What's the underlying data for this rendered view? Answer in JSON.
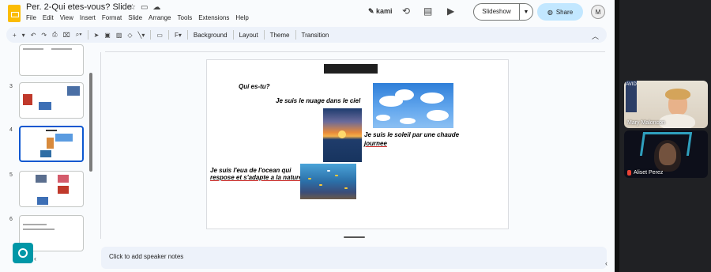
{
  "app": {
    "title": "Per. 2-Qui etes-vous? Slide",
    "menu": [
      "File",
      "Edit",
      "View",
      "Insert",
      "Format",
      "Slide",
      "Arrange",
      "Tools",
      "Extensions",
      "Help"
    ],
    "kami_label": "kami",
    "slideshow_label": "Slideshow",
    "share_label": "Share",
    "avatar_initial": "M"
  },
  "toolbar": {
    "background_label": "Background",
    "layout_label": "Layout",
    "theme_label": "Theme",
    "transition_label": "Transition"
  },
  "filmstrip": {
    "slide_numbers": [
      "3",
      "4",
      "5",
      "6"
    ],
    "active_slide": "4"
  },
  "slide": {
    "q": "Qui es-tu?",
    "line1": "Je suis le nuage dans le ciel",
    "line2a": "Je suis le soleil par une chaude",
    "line2b": "journee",
    "line3a": "Je suis l'eua de l'ocean qui",
    "line3b": "respose et s'adapte a la nature"
  },
  "notes": {
    "placeholder": "Click to add speaker notes"
  },
  "meeting": {
    "participants": [
      "Mary Maloncon",
      "Aliset Perez"
    ],
    "sign_letters": "AVID"
  }
}
